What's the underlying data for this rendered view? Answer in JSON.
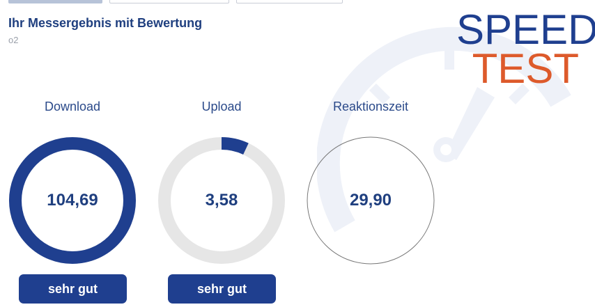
{
  "header": {
    "title": "Ihr Messergebnis mit Bewertung",
    "provider": "o2"
  },
  "logo": {
    "line1": "SPEED",
    "line2": "TEST",
    "color1": "#1f3f8f",
    "color2": "#dd5a2b"
  },
  "metrics": [
    {
      "label": "Download",
      "value": "104,69",
      "fill_fraction": 1.0,
      "rating": "sehr gut"
    },
    {
      "label": "Upload",
      "value": "3,58",
      "fill_fraction": 0.07,
      "rating": "sehr gut"
    },
    {
      "label": "Reaktionszeit",
      "value": "29,90"
    }
  ],
  "colors": {
    "accent": "#1f3f8f",
    "track": "#e6e6e6",
    "text": "#1f3f7f"
  }
}
